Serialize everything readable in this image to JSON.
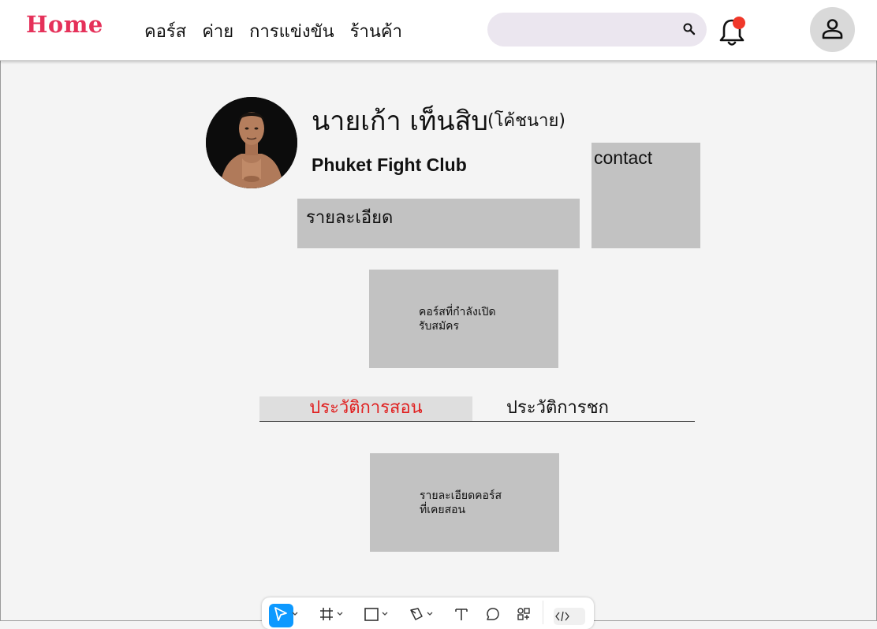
{
  "header": {
    "logo": "Home",
    "nav": [
      "คอร์ส",
      "ค่าย",
      "การแข่งขัน",
      "ร้านค้า"
    ],
    "search_placeholder": ""
  },
  "profile": {
    "name": "นายเก้า เท็นสิบ",
    "role": "(โค้ชนาย)",
    "club": "Phuket Fight Club"
  },
  "sections": {
    "details_label": "รายละเอียด",
    "contact_label": "contact",
    "open_courses_label": "คอร์สที่กำลังเปิด\nรับสมัคร",
    "course_history_label": "รายละเอียดคอร์ส\nที่เคยสอน"
  },
  "tabs": [
    {
      "label": "ประวัติการสอน",
      "active": true
    },
    {
      "label": "ประวัติการชก",
      "active": false
    }
  ],
  "toolbar": {
    "tools": [
      "move-tool",
      "frame-tool",
      "shape-tool",
      "pen-tool",
      "text-tool",
      "comment-tool",
      "actions-tool",
      "dev-mode-toggle"
    ]
  },
  "colors": {
    "brand": "#e5315a",
    "active_tab_text": "#e02020",
    "notification_dot": "#f0382a",
    "toolbar_active": "#0d99ff",
    "placeholder_box": "#c2c2c2"
  }
}
